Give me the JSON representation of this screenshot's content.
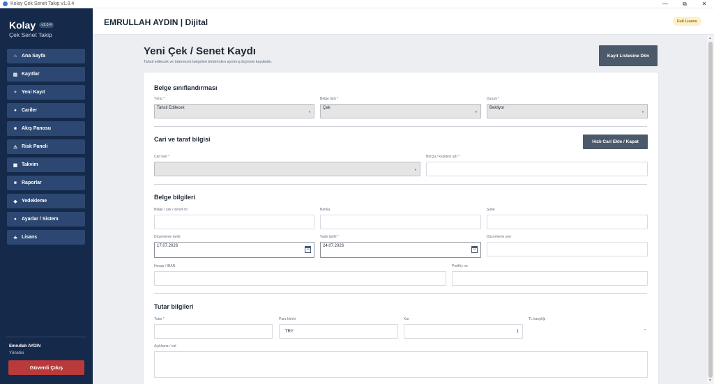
{
  "window": {
    "title": "Kolay Çek Senet Takip v1.0.4",
    "minimize": "—",
    "restore": "⧉",
    "close": "✕"
  },
  "sidebar": {
    "brand": "Kolay",
    "version": "v1.0.4",
    "subtitle": "Çek Senet Takip",
    "items": [
      {
        "label": "Ana Sayfa",
        "icon": "⌂",
        "icon_name": "home-icon"
      },
      {
        "label": "Kayıtlar",
        "icon": "▤",
        "icon_name": "records-icon"
      },
      {
        "label": "Yeni Kayıt",
        "icon": "+",
        "icon_name": "plus-icon"
      },
      {
        "label": "Cariler",
        "icon": "●",
        "icon_name": "accounts-icon"
      },
      {
        "label": "Akış Panosu",
        "icon": "■",
        "icon_name": "flow-icon"
      },
      {
        "label": "Risk Paneli",
        "icon": "⚠",
        "icon_name": "warning-icon"
      },
      {
        "label": "Takvim",
        "icon": "▦",
        "icon_name": "calendar-icon"
      },
      {
        "label": "Raporlar",
        "icon": "■",
        "icon_name": "report-icon"
      },
      {
        "label": "Yedekleme",
        "icon": "◆",
        "icon_name": "backup-icon"
      },
      {
        "label": "Ayarlar / Sistem",
        "icon": "●",
        "icon_name": "settings-icon"
      },
      {
        "label": "Lisans",
        "icon": "★",
        "icon_name": "star-icon"
      }
    ],
    "user_name": "Emrullah AYDIN",
    "user_role": "Yönetici",
    "logout": "Güvenli Çıkış"
  },
  "header": {
    "title": "EMRULLAH AYDIN | Dijital",
    "license": "Full Lisans"
  },
  "page": {
    "title": "Yeni Çek / Senet Kaydı",
    "subtitle": "Tahsil edilecek ve ödenecek belgeleri birbirinden ayrılmış biçimde kaydedin.",
    "list_button": "Kayıt Listesine Dön"
  },
  "form": {
    "classification": {
      "title": "Belge sınıflandırması",
      "direction": {
        "label": "Yönü *",
        "value": "Tahsil Edilecek"
      },
      "type": {
        "label": "Belge türü *",
        "value": "Çek"
      },
      "status": {
        "label": "Durum *",
        "value": "Bekliyor"
      }
    },
    "party": {
      "title": "Cari ve taraf bilgisi",
      "quick_button": "Hızlı Cari Ekle / Kapat",
      "account": {
        "label": "Cari kart *",
        "value": ""
      },
      "debtor": {
        "label": "Borçlu / keşideci adı *",
        "value": ""
      }
    },
    "document": {
      "title": "Belge bilgileri",
      "number": {
        "label": "Belge / çek / senet no",
        "value": ""
      },
      "bank": {
        "label": "Banka",
        "value": ""
      },
      "branch": {
        "label": "Şube",
        "value": ""
      },
      "issue_date": {
        "label": "Düzenleme tarihi",
        "value": "17.07.2026"
      },
      "due_date": {
        "label": "Vade tarihi *",
        "value": "24.07.2026"
      },
      "issue_place": {
        "label": "Düzenleme yeri",
        "value": ""
      },
      "iban": {
        "label": "Hesap / IBAN",
        "value": ""
      },
      "portfolio": {
        "label": "Portföy no",
        "value": ""
      }
    },
    "amount": {
      "title": "Tutar bilgileri",
      "amount": {
        "label": "Tutar *",
        "value": ""
      },
      "currency": {
        "label": "Para birimi",
        "value": "TRY"
      },
      "rate": {
        "label": "Kur",
        "value": "1"
      },
      "tl": {
        "label": "TL karşılığı",
        "value": "-"
      },
      "note": {
        "label": "Açıklama / not",
        "value": ""
      }
    }
  },
  "colors": {
    "sidebar": "#15294a",
    "nav_item": "#2c4872",
    "logout": "#b83a3a",
    "dark_button": "#4b5a6b"
  }
}
